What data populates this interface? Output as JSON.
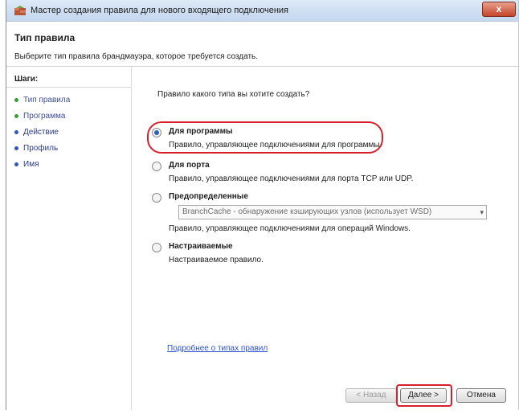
{
  "window": {
    "title": "Мастер создания правила для нового входящего подключения",
    "close_glyph": "x"
  },
  "header": {
    "title": "Тип правила",
    "subtitle": "Выберите тип правила брандмауэра, которое требуется создать."
  },
  "steps": {
    "title": "Шаги:",
    "items": [
      {
        "label": "Тип правила",
        "state": "done"
      },
      {
        "label": "Программа",
        "state": "done"
      },
      {
        "label": "Действие",
        "state": "pending"
      },
      {
        "label": "Профиль",
        "state": "pending"
      },
      {
        "label": "Имя",
        "state": "pending"
      }
    ]
  },
  "main": {
    "question": "Правило какого типа вы хотите создать?",
    "options": [
      {
        "label": "Для программы",
        "description": "Правило, управляющее подключениями для программы.",
        "checked": true
      },
      {
        "label": "Для порта",
        "description": "Правило, управляющее подключениями для порта TCP или UDP.",
        "checked": false
      },
      {
        "label": "Предопределенные",
        "description": "Правило, управляющее подключениями для операций Windows.",
        "checked": false
      },
      {
        "label": "Настраиваемые",
        "description": "Настраиваемое правило.",
        "checked": false
      }
    ],
    "predefined_select": "BranchCache - обнаружение кэширующих узлов (использует WSD)",
    "help_link": "Подробнее о типах правил"
  },
  "buttons": {
    "back": "< Назад",
    "next": "Далее >",
    "cancel": "Отмена"
  },
  "colors": {
    "highlight": "#d9202a",
    "link": "#2b4fd0",
    "step_done": "#3a9e3a",
    "step_pending": "#3057b8"
  }
}
